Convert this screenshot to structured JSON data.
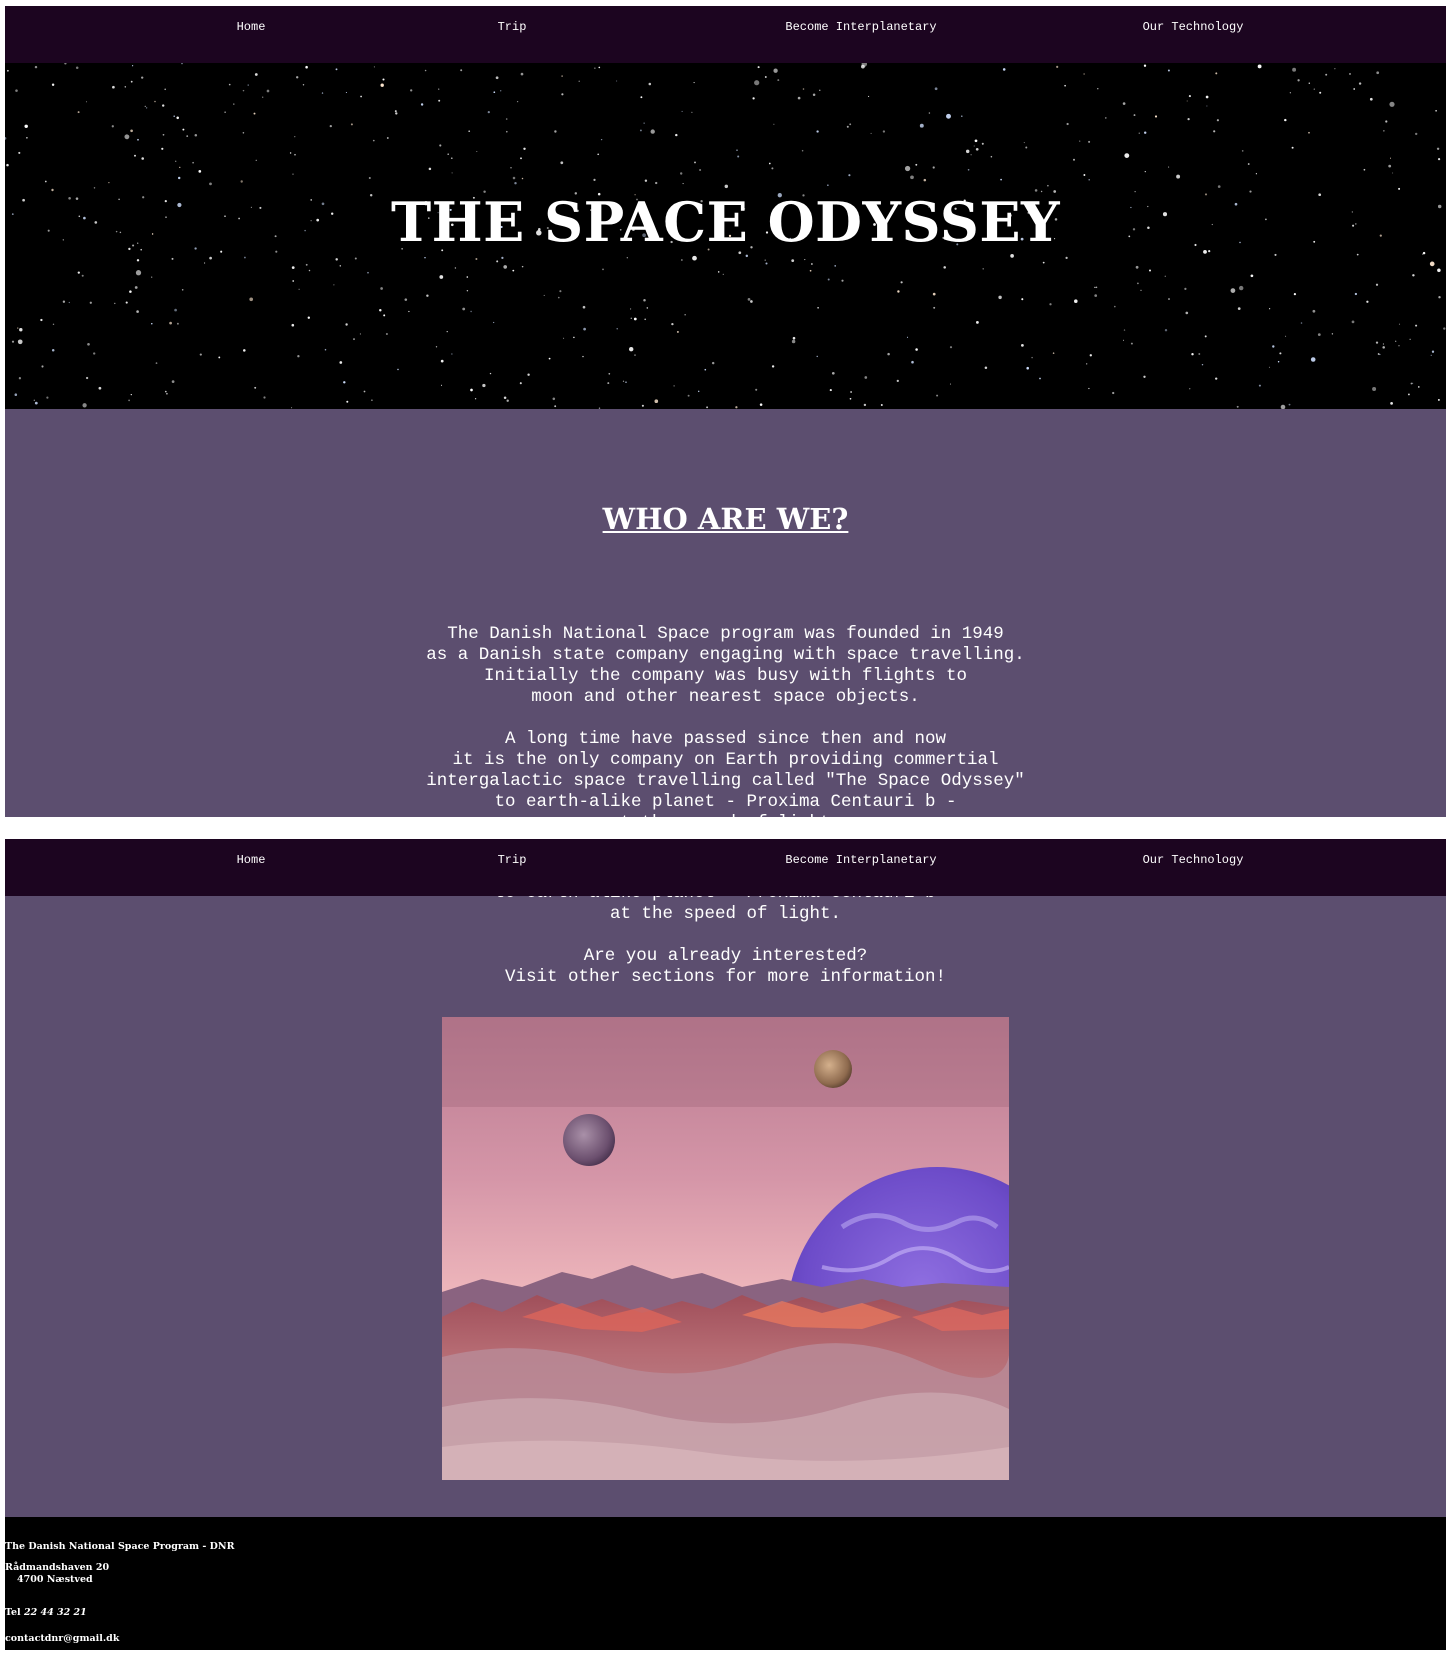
{
  "nav": {
    "home": "Home",
    "trip": "Trip",
    "interplanetary": "Become Interplanetary",
    "technology": "Our Technology"
  },
  "hero": {
    "title": "THE SPACE ODYSSEY"
  },
  "about": {
    "heading": "WHO ARE WE?",
    "lines": [
      "The Danish National Space program was founded in 1949",
      "as a Danish state company engaging with space travelling.",
      "Initially the company was busy with flights to",
      "moon and other nearest space objects.",
      "",
      "A long time have passed since then and now",
      "it is the only company on Earth providing commertial",
      "intergalactic space travelling called \"The Space Odyssey\"",
      "to earth-alike planet - Proxima Centauri b -",
      "at the speed of light.",
      "",
      "Are you already interested?",
      "Visit other sections for more information!"
    ]
  },
  "footer": {
    "org": "The Danish National Space Program - DNR",
    "street": "Rådmandshaven 20",
    "city": "4700 Næstved",
    "tel_label": "Tel",
    "tel_number": "22 44 32 21",
    "email": "contactdnr@gmail.dk"
  },
  "colors": {
    "navbar": "#1c0520",
    "section_bg": "#5c4e6f",
    "hero_bg": "#000000",
    "footer_bg": "#000000",
    "text": "#ffffff"
  }
}
